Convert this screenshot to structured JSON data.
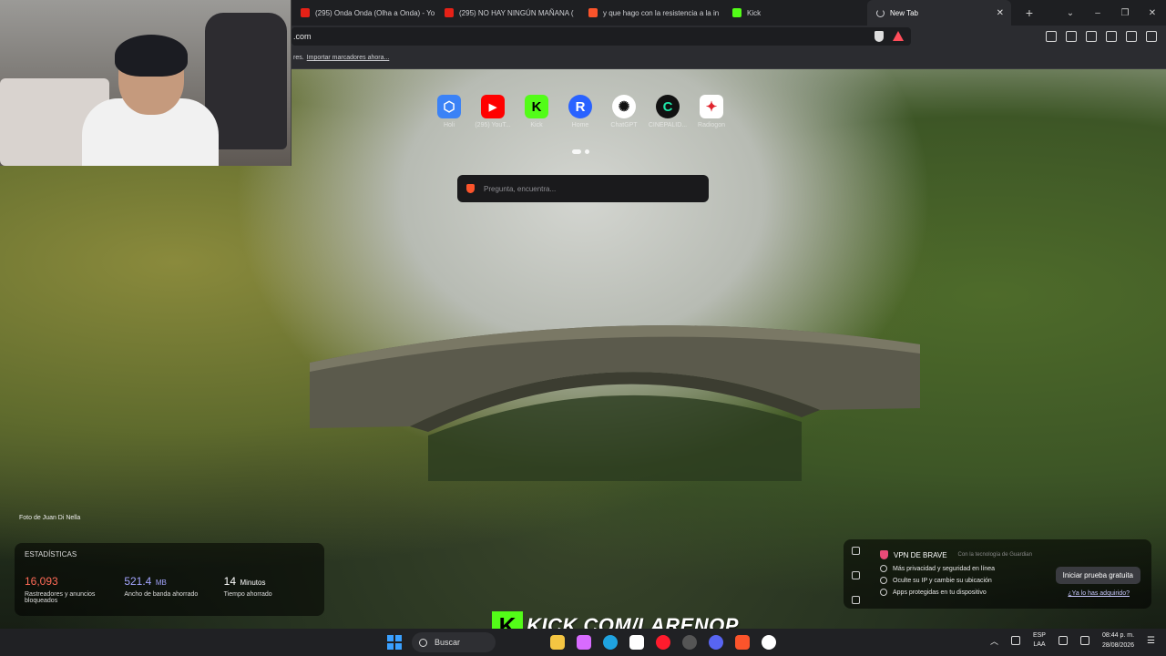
{
  "tabs": [
    {
      "label": "(295) Onda Onda (Olha a Onda) - Yo",
      "icon": "youtube-icon",
      "color": "#e62117"
    },
    {
      "label": "(295) NO HAY NINGÚN MAÑANA (",
      "icon": "youtube-icon",
      "color": "#e62117"
    },
    {
      "label": "y que hago con la resistencia a la in",
      "icon": "brave-icon",
      "color": "#fb542b"
    },
    {
      "label": "Kick",
      "icon": "kick-icon",
      "color": "#53fc18"
    }
  ],
  "active_tab": {
    "label": "New Tab",
    "close": "✕"
  },
  "new_tab_button": "+",
  "window_controls": [
    "⌄",
    "–",
    "❐",
    "✕"
  ],
  "address_bar": {
    "value": ".com"
  },
  "bookmarks": {
    "prefix": "res.",
    "import_link": "Importar marcadores ahora..."
  },
  "shortcuts": [
    {
      "glyph": "⬡",
      "label": "Holi",
      "bg": "#3b82f6",
      "fg": "#ffffff"
    },
    {
      "glyph": "▶",
      "label": "(295) YouT...",
      "bg": "#ff0000",
      "fg": "#ffffff"
    },
    {
      "glyph": "K",
      "label": "Kick",
      "bg": "#53fc18",
      "fg": "#000000"
    },
    {
      "glyph": "R",
      "label": "Home",
      "bg": "#2962ff",
      "fg": "#ffffff"
    },
    {
      "glyph": "✺",
      "label": "ChatGPT",
      "bg": "#ffffff",
      "fg": "#111111"
    },
    {
      "glyph": "C",
      "label": "CINEPALID...",
      "bg": "#111111",
      "fg": "#1ee3a6"
    },
    {
      "glyph": "✦",
      "label": "Radiogon",
      "bg": "#ffffff",
      "fg": "#e0242e"
    }
  ],
  "search": {
    "placeholder": "Pregunta, encuentra..."
  },
  "photo_credit": "Foto de Juan Di Nella",
  "stats": {
    "title": "ESTADÍSTICAS",
    "items": [
      {
        "value": "16,093",
        "unit": "",
        "desc": "Rastreadores y anuncios bloqueados",
        "color": "#ff6b57"
      },
      {
        "value": "521.4",
        "unit": "MB",
        "desc": "Ancho de banda ahorrado",
        "color": "#a4a6ff"
      },
      {
        "value": "14",
        "unit": "Minutos",
        "desc": "Tiempo ahorrado",
        "color": "#ffffff"
      }
    ]
  },
  "vpn": {
    "title": "VPN DE BRAVE",
    "powered": "Con la tecnología de  Guardian",
    "features": [
      "Más privacidad y seguridad en línea",
      "Oculte su IP y cambie su ubicación",
      "Apps protegidas en tu dispositivo"
    ],
    "trial_button": "Iniciar prueba gratuita",
    "already_link": "¿Ya lo has adquirido?"
  },
  "overlay": {
    "letter": "K",
    "text": "KICK.COM/LARENOP"
  },
  "taskbar": {
    "search_label": "Buscar",
    "apps": [
      {
        "name": "file-explorer",
        "color": "#f4c542"
      },
      {
        "name": "copilot",
        "color": "#d86bff"
      },
      {
        "name": "edge",
        "color": "#1fa3e0"
      },
      {
        "name": "store",
        "color": "#ffffff"
      },
      {
        "name": "opera",
        "color": "#ff1b2d"
      },
      {
        "name": "steam",
        "color": "#2a2a2a"
      },
      {
        "name": "discord",
        "color": "#5865f2"
      },
      {
        "name": "brave",
        "color": "#fb542b"
      },
      {
        "name": "obs",
        "color": "#ffffff"
      }
    ],
    "lang_top": "ESP",
    "lang_bottom": "LAA",
    "time": "08:44 p. m.",
    "date": "28/08/2026"
  }
}
